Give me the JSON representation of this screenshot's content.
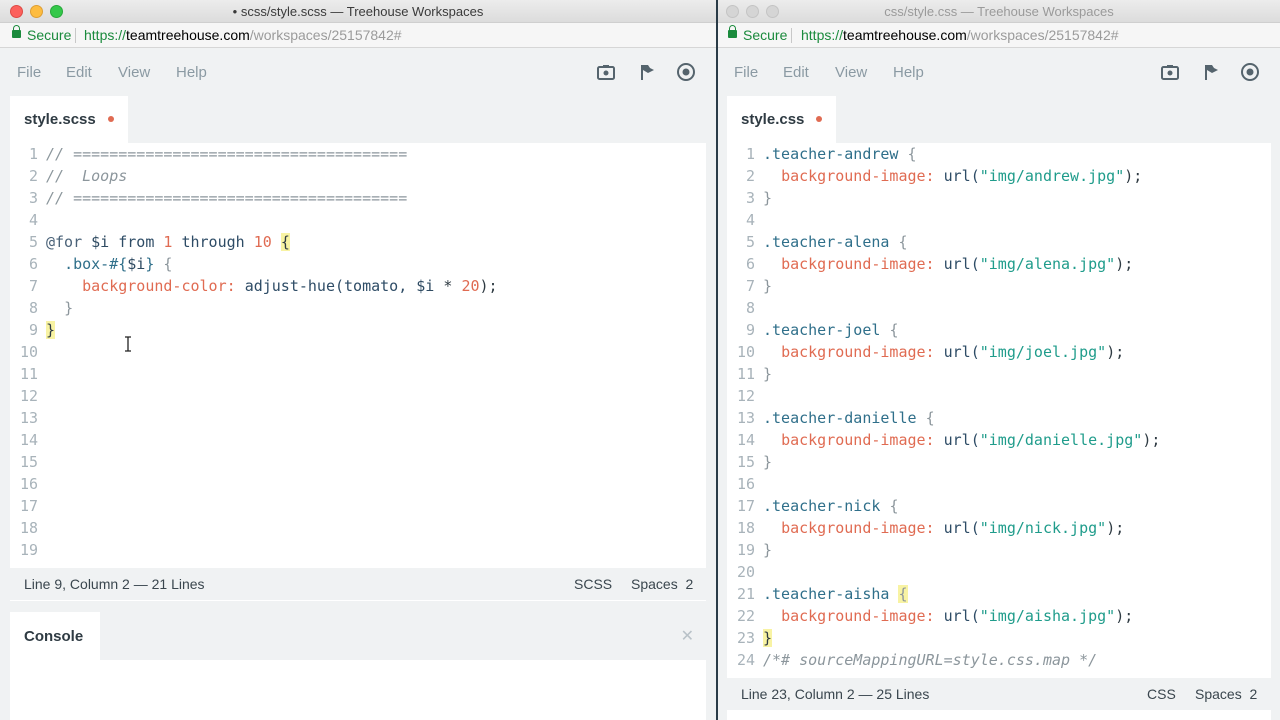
{
  "left_window": {
    "title": "• scss/style.scss — Treehouse Workspaces",
    "secure_label": "Secure",
    "url": {
      "proto": "https://",
      "host": "teamtreehouse.com",
      "path": "/workspaces/25157842#"
    },
    "menu": {
      "file": "File",
      "edit": "Edit",
      "view": "View",
      "help": "Help"
    },
    "tab": {
      "label": "style.scss",
      "dirty": true
    },
    "line_numbers": [
      "1",
      "2",
      "3",
      "4",
      "5",
      "6",
      "7",
      "8",
      "9",
      "10",
      "11",
      "12",
      "13",
      "14",
      "15",
      "16",
      "17",
      "18",
      "19"
    ],
    "code": {
      "l1": "// =====================================",
      "l2": "//  Loops",
      "l3": "// =====================================",
      "l5_at": "@for",
      "l5_var": "$i",
      "l5_from": "from",
      "l5_n1": "1",
      "l5_through": "through",
      "l5_n2": "10",
      "l5_brace": "{",
      "l6_sel": ".box-#{",
      "l6_var": "$i",
      "l6_close": "}",
      "l6_brace": "{",
      "l7_prop": "background-color:",
      "l7_fn": "adjust-hue(tomato, ",
      "l7_var": "$i",
      "l7_op": " * ",
      "l7_num": "20",
      "l7_end": ");",
      "l8": "}",
      "l9": "}"
    },
    "status": {
      "position": "Line 9, Column 2 — 21 Lines",
      "mode": "SCSS",
      "indent": "Spaces  2"
    },
    "console": {
      "label": "Console",
      "close": "✕"
    }
  },
  "right_window": {
    "title": "css/style.css — Treehouse Workspaces",
    "secure_label": "Secure",
    "url": {
      "proto": "https://",
      "host": "teamtreehouse.com",
      "path": "/workspaces/25157842#"
    },
    "menu": {
      "file": "File",
      "edit": "Edit",
      "view": "View",
      "help": "Help"
    },
    "tab": {
      "label": "style.css",
      "dirty": true
    },
    "line_numbers": [
      "1",
      "2",
      "3",
      "4",
      "5",
      "6",
      "7",
      "8",
      "9",
      "10",
      "11",
      "12",
      "13",
      "14",
      "15",
      "16",
      "17",
      "18",
      "19",
      "20",
      "21",
      "22",
      "23",
      "24"
    ],
    "code": {
      "prop": "background-image:",
      "url_fn": "url(",
      "url_close": ");",
      "open": "{",
      "close": "}",
      "rules": [
        {
          "selector": ".teacher-andrew",
          "path": "\"img/andrew.jpg\""
        },
        {
          "selector": ".teacher-alena",
          "path": "\"img/alena.jpg\""
        },
        {
          "selector": ".teacher-joel",
          "path": "\"img/joel.jpg\""
        },
        {
          "selector": ".teacher-danielle",
          "path": "\"img/danielle.jpg\""
        },
        {
          "selector": ".teacher-nick",
          "path": "\"img/nick.jpg\""
        },
        {
          "selector": ".teacher-aisha",
          "path": "\"img/aisha.jpg\""
        }
      ],
      "sourcemap": "/*# sourceMappingURL=style.css.map */"
    },
    "status": {
      "position": "Line 23, Column 2 — 25 Lines",
      "mode": "CSS",
      "indent": "Spaces  2"
    }
  },
  "icons": [
    "screenshot-icon",
    "share-icon",
    "preview-eye-icon"
  ]
}
